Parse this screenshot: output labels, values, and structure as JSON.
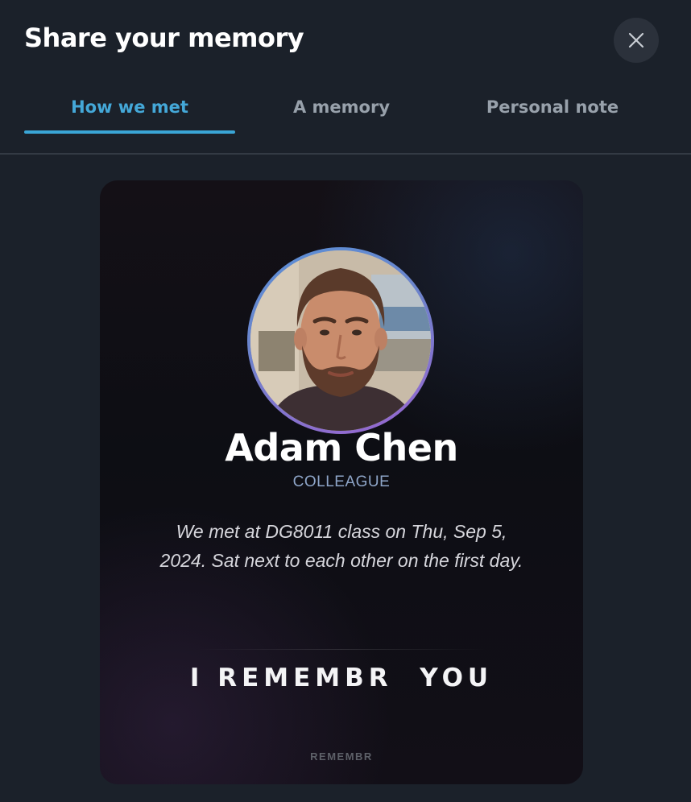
{
  "modal": {
    "title": "Share your memory",
    "close_icon": "close-icon"
  },
  "tabs": [
    {
      "label": "How we met",
      "active": true
    },
    {
      "label": "A memory",
      "active": false
    },
    {
      "label": "Personal note",
      "active": false
    }
  ],
  "card": {
    "name": "Adam Chen",
    "relation": "COLLEAGUE",
    "memory": "We met at DG8011 class on Thu, Sep 5, 2024. Sat next to each other on the first day.",
    "tagline": "I REMEMBR  YOU",
    "brand": "REMEMBR"
  },
  "colors": {
    "background": "#1b212a",
    "accent": "#3aa6d6",
    "card_bg": "#0d0e14",
    "relation": "#8ea5c8"
  }
}
